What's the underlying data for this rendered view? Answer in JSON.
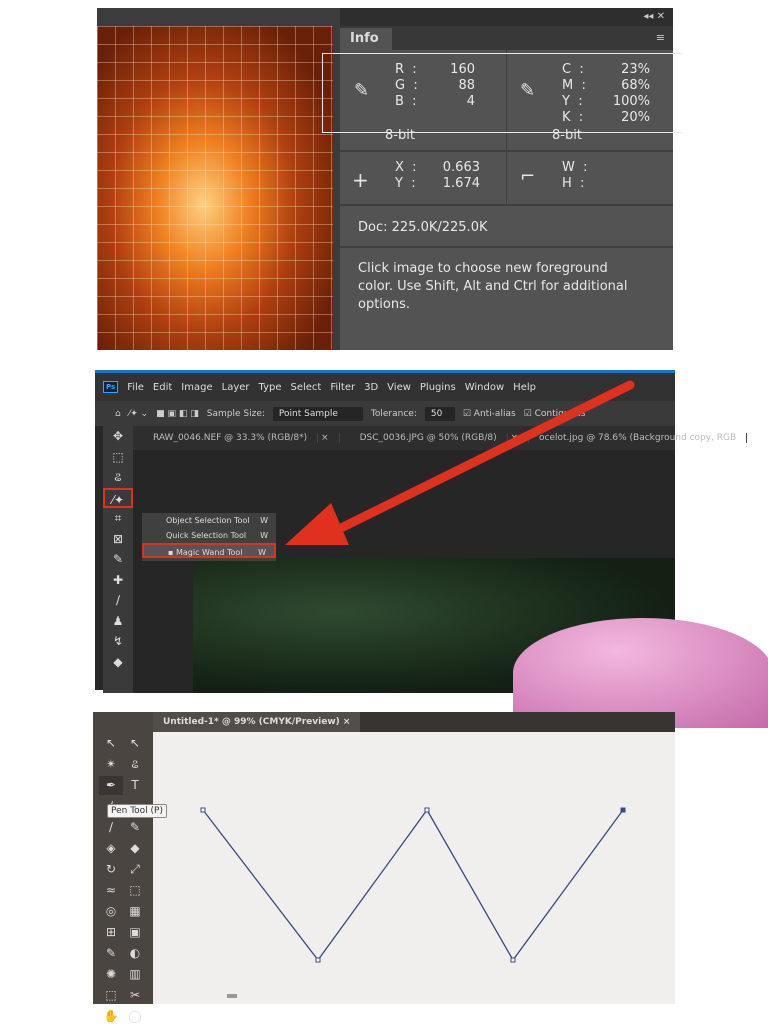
{
  "info_panel": {
    "tab": "Info",
    "controls": "◂◂ ✕",
    "menu_icon": "panel-menu-icon",
    "rgb": {
      "R": "160",
      "G": "88",
      "B": "4",
      "depth": "8-bit"
    },
    "cmyk": {
      "C": "23%",
      "M": "68%",
      "Y": "100%",
      "K": "20%",
      "depth": "8-bit"
    },
    "coords": {
      "X": "0.663",
      "Y": "1.674"
    },
    "size": {
      "W": "",
      "H": ""
    },
    "doc": "Doc: 225.0K/225.0K",
    "hint": "Click image to choose new foreground color.  Use Shift, Alt and Ctrl for additional options."
  },
  "photoshop": {
    "logo": "Ps",
    "menu": [
      "File",
      "Edit",
      "Image",
      "Layer",
      "Type",
      "Select",
      "Filter",
      "3D",
      "View",
      "Plugins",
      "Window",
      "Help"
    ],
    "options": {
      "sample_size_label": "Sample Size:",
      "sample_size": "Point Sample",
      "tolerance_label": "Tolerance:",
      "tolerance": "50",
      "anti_alias": "Anti-alias",
      "contiguous": "Contiguous"
    },
    "tabs": [
      "RAW_0046.NEF @ 33.3% (RGB/8*)",
      "DSC_0036.JPG @ 50% (RGB/8)",
      "ocelot.jpg @ 78.6% (Background copy, RGB"
    ],
    "flyout": [
      {
        "label": "Object Selection Tool",
        "key": "W"
      },
      {
        "label": "Quick Selection Tool",
        "key": "W"
      },
      {
        "label": "Magic Wand Tool",
        "key": "W"
      }
    ],
    "accent": "#e0301e"
  },
  "illustrator": {
    "tab": "Untitled-1* @ 99% (CMYK/Preview)",
    "tooltip": "Pen Tool (P)",
    "path_color": "#3a4a80"
  }
}
